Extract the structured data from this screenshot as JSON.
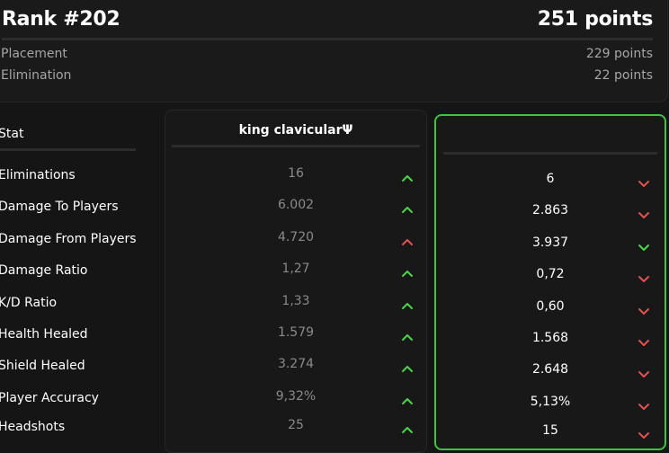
{
  "header": {
    "rank": "Rank #202",
    "total": "251 points",
    "breakdown": [
      {
        "label": "Placement",
        "value": "229 points"
      },
      {
        "label": "Elimination",
        "value": "22 points"
      }
    ]
  },
  "stats": {
    "column_header": "Stat",
    "labels": [
      "Eliminations",
      "Damage To Players",
      "Damage From Players",
      "Damage Ratio",
      "K/D Ratio",
      "Health Healed",
      "Shield Healed",
      "Player Accuracy",
      "Headshots"
    ]
  },
  "player1": {
    "name": "king clavicularΨ",
    "values": [
      "16",
      "6.002",
      "4.720",
      "1,27",
      "1,33",
      "1.579",
      "3.274",
      "9,32%",
      "25"
    ],
    "trends": [
      "up-green",
      "up-green",
      "up-red",
      "up-green",
      "up-green",
      "up-green",
      "up-green",
      "up-green",
      "up-green"
    ]
  },
  "player2": {
    "name": "",
    "values": [
      "6",
      "2.863",
      "3.937",
      "0,72",
      "0,60",
      "1.568",
      "2.648",
      "5,13%",
      "15"
    ],
    "trends": [
      "down-red",
      "down-red",
      "down-green",
      "down-red",
      "down-red",
      "down-red",
      "down-red",
      "down-red",
      "down-red"
    ]
  },
  "colors": {
    "green": "#4ad64a",
    "red": "#e25252",
    "highlight_border": "#3ec43e"
  },
  "icons": {
    "up": "chevron-up-icon",
    "down": "chevron-down-icon"
  }
}
